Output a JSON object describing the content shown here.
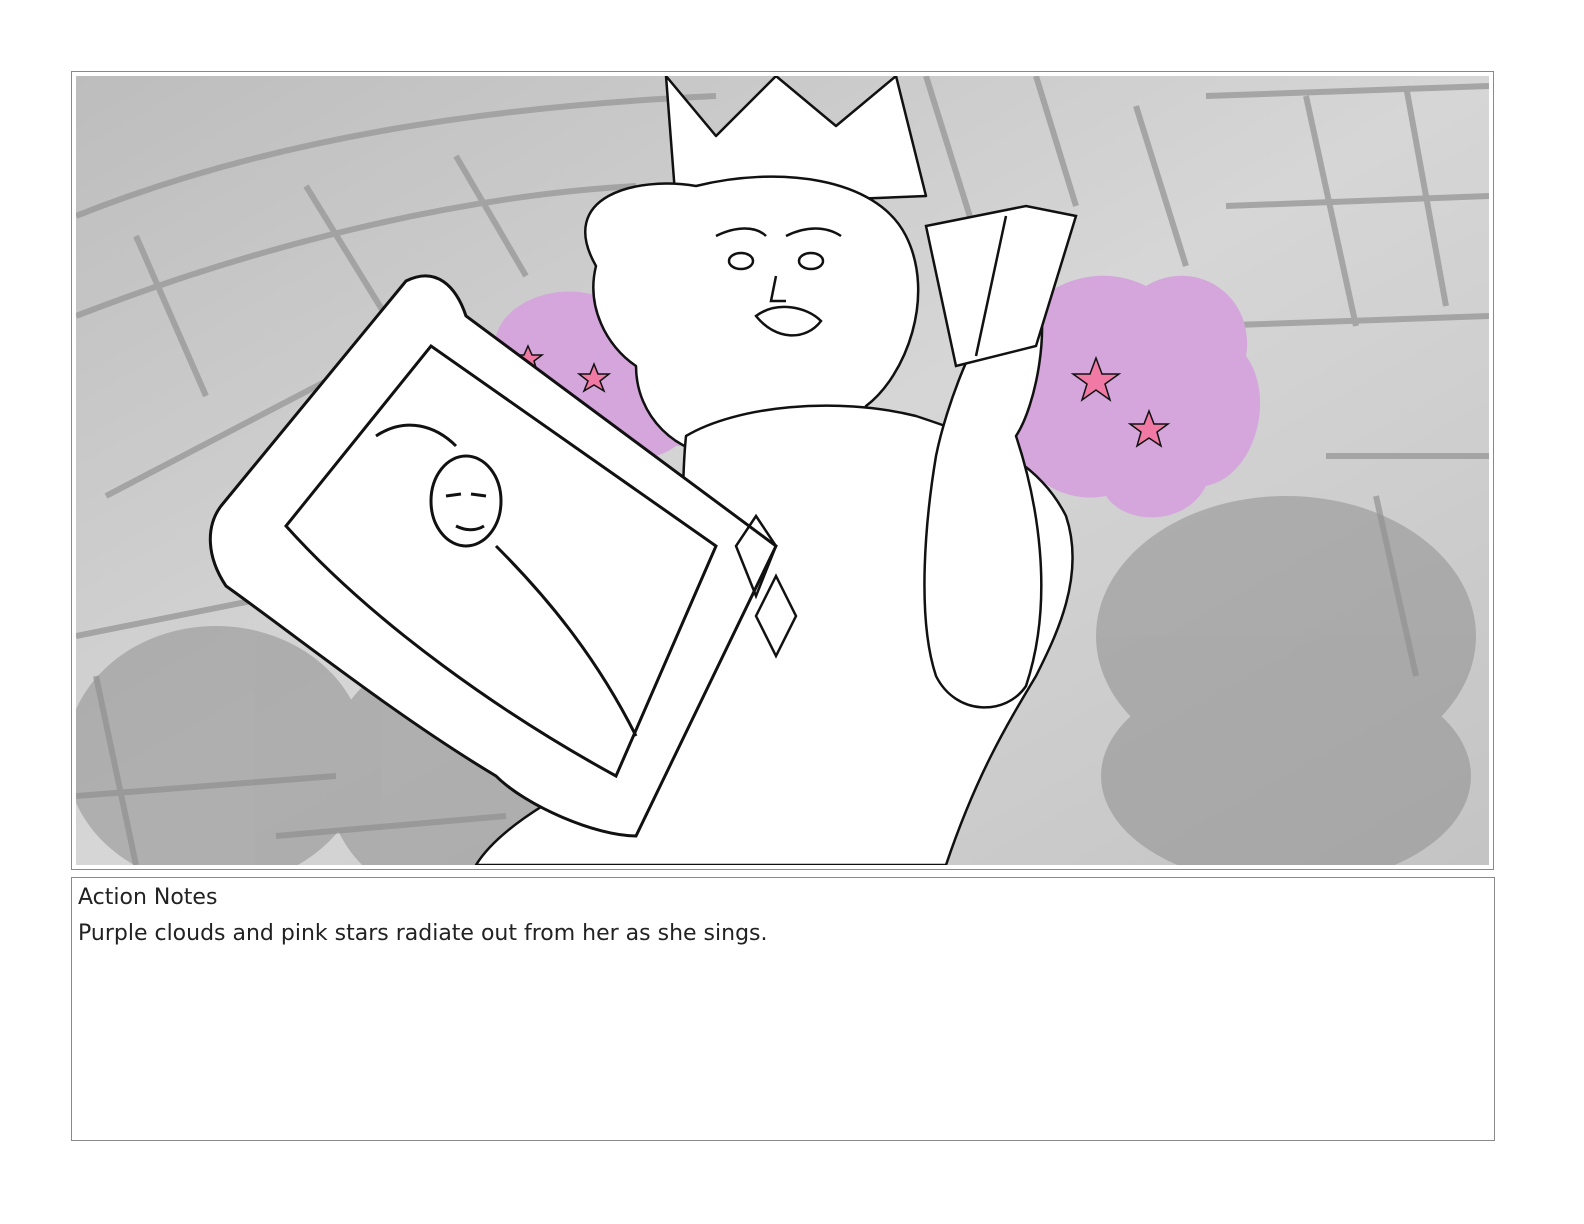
{
  "panel": {
    "image_alt": "Storyboard sketch: a woman with a tall crown sings while holding an ornate framed portrait and a small book, with purple clouds and pink stars behind her",
    "colors": {
      "background_gray": "#c9c9c9",
      "cloud_purple": "#d4a6dc",
      "star_pink": "#f07aa4",
      "line_black": "#111111"
    }
  },
  "notes": {
    "heading": "Action Notes",
    "body": "Purple clouds and pink stars radiate out from her as she sings."
  }
}
